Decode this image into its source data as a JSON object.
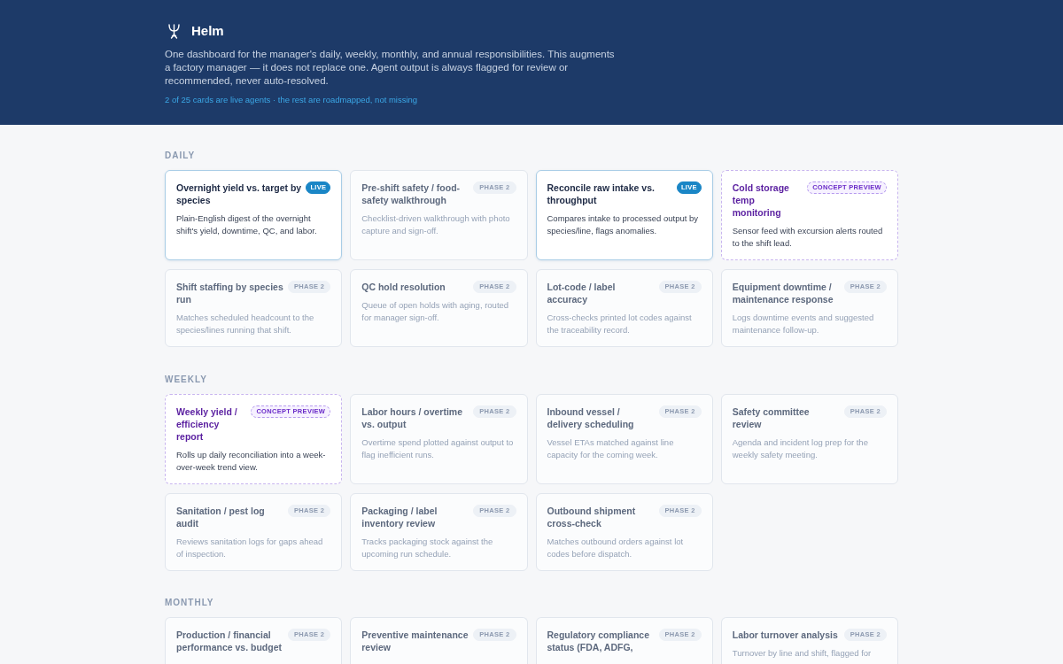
{
  "header": {
    "title": "Helm",
    "description": "One dashboard for the manager's daily, weekly, monthly, and annual responsibilities. This augments a factory manager — it does not replace one. Agent output is always flagged for review or recommended, never auto-resolved.",
    "summary": "2 of 25 cards are live agents · the rest are roadmapped, not missing"
  },
  "sections": [
    {
      "label": "DAILY",
      "cards": [
        {
          "kind": "live",
          "title": "Overnight yield vs. target by species",
          "badge": "LIVE",
          "description": "Plain-English digest of the overnight shift's yield, downtime, QC, and labor."
        },
        {
          "kind": "planned",
          "title": "Pre-shift safety / food-safety walkthrough",
          "badge": "PHASE 2",
          "description": "Checklist-driven walkthrough with photo capture and sign-off."
        },
        {
          "kind": "live",
          "title": "Reconcile raw intake vs. throughput",
          "badge": "LIVE",
          "description": "Compares intake to processed output by species/line, flags anomalies."
        },
        {
          "kind": "concept",
          "title": "Cold storage temp monitoring",
          "badge": "CONCEPT PREVIEW",
          "description": "Sensor feed with excursion alerts routed to the shift lead."
        },
        {
          "kind": "planned",
          "title": "Shift staffing by species run",
          "badge": "PHASE 2",
          "description": "Matches scheduled headcount to the species/lines running that shift."
        },
        {
          "kind": "planned",
          "title": "QC hold resolution",
          "badge": "PHASE 2",
          "description": "Queue of open holds with aging, routed for manager sign-off."
        },
        {
          "kind": "planned",
          "title": "Lot-code / label accuracy",
          "badge": "PHASE 2",
          "description": "Cross-checks printed lot codes against the traceability record."
        },
        {
          "kind": "planned",
          "title": "Equipment downtime / maintenance response",
          "badge": "PHASE 2",
          "description": "Logs downtime events and suggested maintenance follow-up."
        }
      ]
    },
    {
      "label": "WEEKLY",
      "cards": [
        {
          "kind": "concept",
          "title": "Weekly yield / efficiency report",
          "badge": "CONCEPT PREVIEW",
          "description": "Rolls up daily reconciliation into a week-over-week trend view."
        },
        {
          "kind": "planned",
          "title": "Labor hours / overtime vs. output",
          "badge": "PHASE 2",
          "description": "Overtime spend plotted against output to flag inefficient runs."
        },
        {
          "kind": "planned",
          "title": "Inbound vessel / delivery scheduling",
          "badge": "PHASE 2",
          "description": "Vessel ETAs matched against line capacity for the coming week."
        },
        {
          "kind": "planned",
          "title": "Safety committee review",
          "badge": "PHASE 2",
          "description": "Agenda and incident log prep for the weekly safety meeting."
        },
        {
          "kind": "planned",
          "title": "Sanitation / pest log audit",
          "badge": "PHASE 2",
          "description": "Reviews sanitation logs for gaps ahead of inspection."
        },
        {
          "kind": "planned",
          "title": "Packaging / label inventory review",
          "badge": "PHASE 2",
          "description": "Tracks packaging stock against the upcoming run schedule."
        },
        {
          "kind": "planned",
          "title": "Outbound shipment cross-check",
          "badge": "PHASE 2",
          "description": "Matches outbound orders against lot codes before dispatch."
        }
      ]
    },
    {
      "label": "MONTHLY",
      "cards": [
        {
          "kind": "planned",
          "title": "Production / financial performance vs. budget",
          "badge": "PHASE 2"
        },
        {
          "kind": "planned",
          "title": "Preventive maintenance review",
          "badge": "PHASE 2"
        },
        {
          "kind": "planned",
          "title": "Regulatory compliance status (FDA, ADFG,",
          "badge": "PHASE 2"
        },
        {
          "kind": "planned",
          "title": "Labor turnover analysis",
          "badge": "PHASE 2",
          "description": "Turnover by line and shift, flagged for"
        }
      ]
    }
  ]
}
